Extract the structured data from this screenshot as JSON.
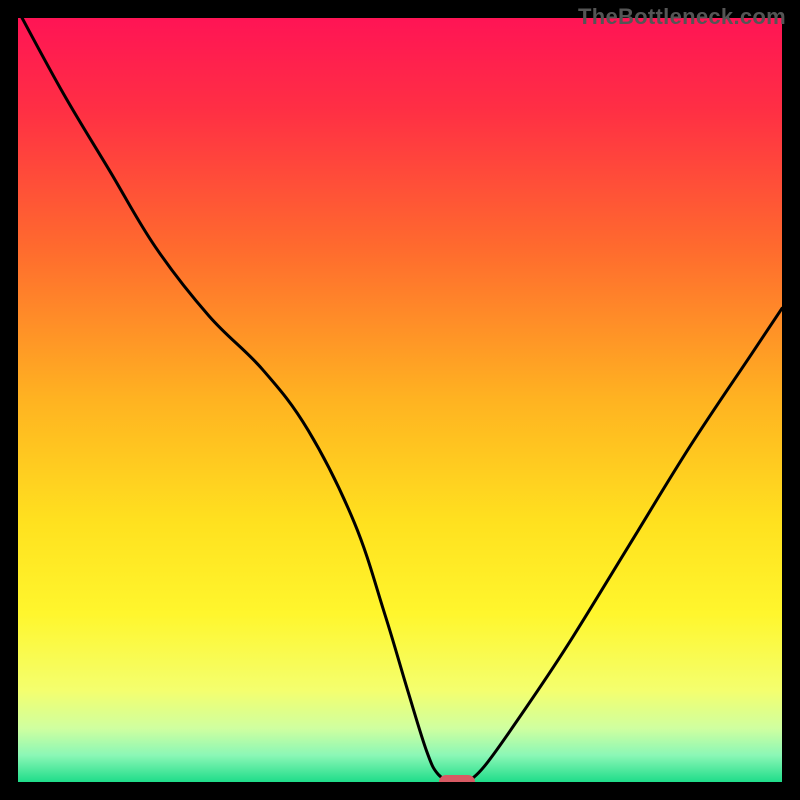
{
  "watermark": "TheBottleneck.com",
  "colors": {
    "frame_bg": "#000000",
    "watermark": "#555555",
    "curve": "#000000",
    "marker": "#d85a63",
    "gradient_stops": [
      {
        "offset": 0.0,
        "color": "#ff1455"
      },
      {
        "offset": 0.12,
        "color": "#ff2f44"
      },
      {
        "offset": 0.3,
        "color": "#ff6a2e"
      },
      {
        "offset": 0.5,
        "color": "#ffb321"
      },
      {
        "offset": 0.66,
        "color": "#ffe11f"
      },
      {
        "offset": 0.78,
        "color": "#fff62d"
      },
      {
        "offset": 0.88,
        "color": "#f4ff6e"
      },
      {
        "offset": 0.93,
        "color": "#cfffa0"
      },
      {
        "offset": 0.965,
        "color": "#8bf7b6"
      },
      {
        "offset": 1.0,
        "color": "#1fdd8a"
      }
    ]
  },
  "chart_data": {
    "type": "line",
    "title": "",
    "xlabel": "",
    "ylabel": "",
    "xlim": [
      0,
      100
    ],
    "ylim": [
      0,
      100
    ],
    "grid": false,
    "legend": false,
    "series": [
      {
        "name": "bottleneck-curve",
        "x": [
          0,
          6,
          12,
          18,
          25,
          32,
          38,
          44,
          48,
          51,
          53.5,
          55,
          57,
          58.5,
          61,
          66,
          72,
          80,
          88,
          96,
          100
        ],
        "y": [
          101,
          90,
          80,
          70,
          61,
          54,
          46,
          34,
          22,
          12,
          4,
          1,
          0,
          0,
          2,
          9,
          18,
          31,
          44,
          56,
          62
        ]
      }
    ],
    "marker": {
      "x": 57.5,
      "y": 0,
      "color": "#d85a63"
    }
  }
}
